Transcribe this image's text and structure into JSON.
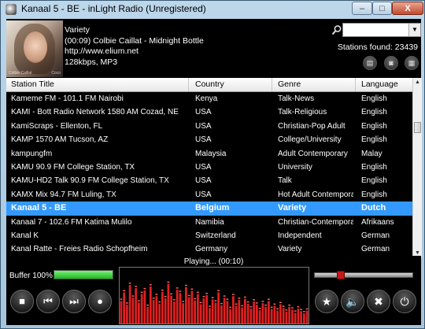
{
  "window": {
    "title": "Kanaal 5 - BE - inLight Radio (Unregistered)",
    "min_label": "–",
    "max_label": "□",
    "close_label": "X"
  },
  "now_playing": {
    "genre": "Variety",
    "track": "(00:09) Colbie Caillat - Midnight Bottle",
    "url": "http://www.elium.net",
    "format": "128kbps, MP3",
    "art_caption": "Colbie Caillat",
    "art_watermark": "Coco"
  },
  "search": {
    "value": "",
    "stations_found": "Stations found: 23439"
  },
  "table": {
    "columns": [
      "Station Title",
      "Country",
      "Genre",
      "Language"
    ],
    "rows": [
      {
        "title": "Kameme FM - 101.1 FM Nairobi",
        "country": "Kenya",
        "genre": "Talk-News",
        "language": "English"
      },
      {
        "title": "KAMI - Bott Radio Network 1580 AM Cozad, NE",
        "country": "USA",
        "genre": "Talk-Religious",
        "language": "English"
      },
      {
        "title": "KamiScraps - Ellenton, FL",
        "country": "USA",
        "genre": "Christian-Pop Adult",
        "language": "English"
      },
      {
        "title": "KAMP 1570 AM Tucson, AZ",
        "country": "USA",
        "genre": "College/University",
        "language": "English"
      },
      {
        "title": "kampungfm",
        "country": "Malaysia",
        "genre": "Adult Contemporary",
        "language": "Malay"
      },
      {
        "title": "KAMU 90.9 FM College Station, TX",
        "country": "USA",
        "genre": "University",
        "language": "English"
      },
      {
        "title": "KAMU-HD2 Talk 90.9 FM College Station, TX",
        "country": "USA",
        "genre": "Talk",
        "language": "English"
      },
      {
        "title": "KAMX Mix 94.7 FM Luling, TX",
        "country": "USA",
        "genre": "Hot Adult Contempora...",
        "language": "English"
      },
      {
        "title": "Kanaal 5 - BE",
        "country": "Belgium",
        "genre": "Variety",
        "language": "Dutch"
      },
      {
        "title": "Kanaal 7 - 102.6 FM Katima Mulilo",
        "country": "Namibia",
        "genre": "Christian-Contempora...",
        "language": "Afrikaans"
      },
      {
        "title": "Kanal K",
        "country": "Switzerland",
        "genre": "Independent",
        "language": "German"
      },
      {
        "title": "Kanal Ratte - Freies Radio Schopfheim",
        "country": "Germany",
        "genre": "Variety",
        "language": "German"
      }
    ],
    "selected_index": 8
  },
  "player": {
    "buffer_label": "Buffer 100%",
    "buffer_percent": 100,
    "status": "Playing... (00:10)",
    "volume_fraction": 0.24
  },
  "visualizer": {
    "levels": [
      0.42,
      0.58,
      0.35,
      0.72,
      0.48,
      0.66,
      0.39,
      0.55,
      0.62,
      0.31,
      0.69,
      0.44,
      0.51,
      0.37,
      0.59,
      0.47,
      0.74,
      0.52,
      0.41,
      0.63,
      0.57,
      0.38,
      0.68,
      0.49,
      0.61,
      0.43,
      0.55,
      0.36,
      0.47,
      0.53,
      0.29,
      0.45,
      0.39,
      0.58,
      0.34,
      0.48,
      0.42,
      0.27,
      0.51,
      0.33,
      0.44,
      0.3,
      0.46,
      0.37,
      0.28,
      0.41,
      0.35,
      0.25,
      0.38,
      0.31,
      0.42,
      0.27,
      0.33,
      0.24,
      0.36,
      0.29,
      0.22,
      0.31,
      0.26,
      0.2,
      0.28,
      0.23,
      0.19,
      0.24
    ],
    "bar_color": "#e02020",
    "peak_color": "#ff6666"
  },
  "icons": {
    "search": "search-icon",
    "stop": "stop-icon",
    "previous": "previous-icon",
    "next": "next-icon",
    "record": "record-icon",
    "favorite": "star-icon",
    "mute": "speaker-icon",
    "settings": "tools-icon",
    "power": "power-icon"
  },
  "colors": {
    "selection": "#3399ff",
    "buffer": "#2ec42e",
    "volume_knob": "#c81818"
  }
}
